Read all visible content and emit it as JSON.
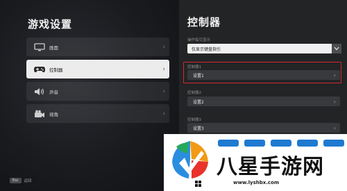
{
  "left": {
    "title": "游戏设置",
    "menu": [
      {
        "label": "画面",
        "icon": "monitor-icon"
      },
      {
        "label": "控制器",
        "icon": "gamepad-icon"
      },
      {
        "label": "声音",
        "icon": "speaker-icon"
      },
      {
        "label": "视角",
        "icon": "camera-icon"
      }
    ],
    "footer": {
      "key": "Esc",
      "label": "返回"
    }
  },
  "right": {
    "title": "控制器",
    "hint_label": "操作指引显示",
    "hint_value": "仅显示键盘指引",
    "controllers": [
      {
        "label": "控制器1",
        "value": "设置1"
      },
      {
        "label": "控制器2",
        "value": "设置2"
      },
      {
        "label": "控制器3",
        "value": "设置3"
      }
    ]
  },
  "watermark": {
    "title": "八星手游网",
    "url": "www.lyshbx.com"
  },
  "colors": {
    "accent_red": "#d0282c",
    "active_item": "#ececec",
    "brand_blue": "#1e7ad0"
  }
}
